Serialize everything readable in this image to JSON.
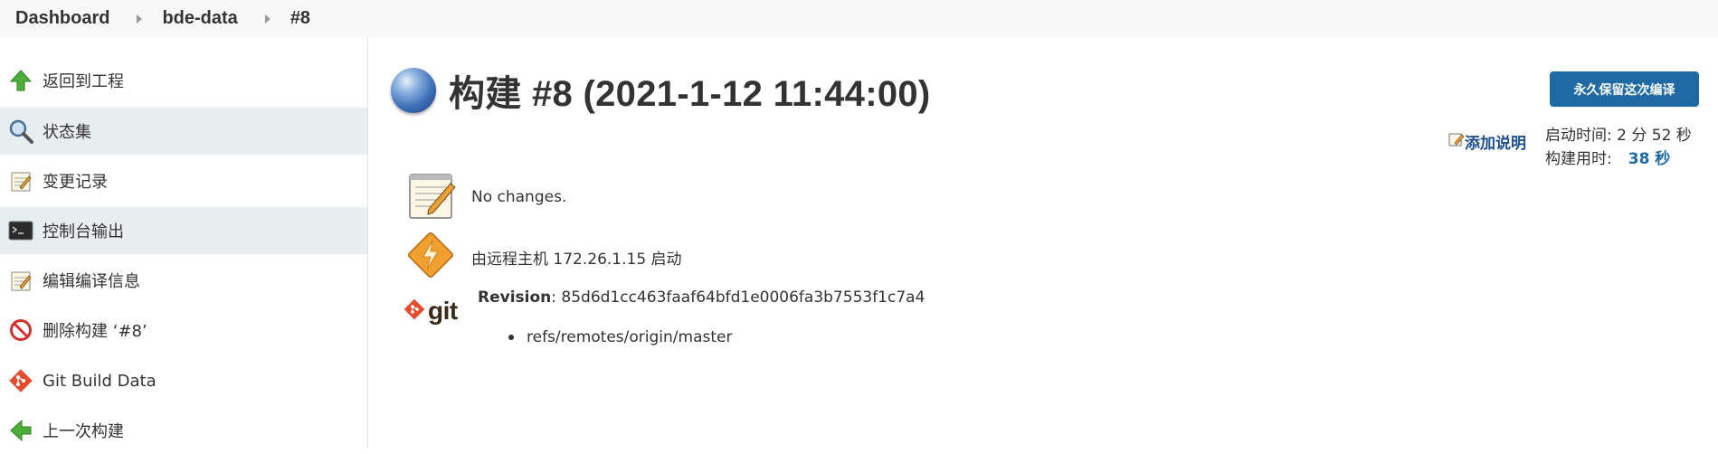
{
  "breadcrumb": {
    "dashboard": "Dashboard",
    "project": "bde-data",
    "build": "#8"
  },
  "sidebar": {
    "items": [
      {
        "label": "返回到工程",
        "icon": "up-arrow-icon"
      },
      {
        "label": "状态集",
        "icon": "magnifier-icon"
      },
      {
        "label": "变更记录",
        "icon": "notepad-icon"
      },
      {
        "label": "控制台输出",
        "icon": "terminal-icon"
      },
      {
        "label": "编辑编译信息",
        "icon": "notepad-icon"
      },
      {
        "label": "删除构建 ‘#8’",
        "icon": "no-entry-icon"
      },
      {
        "label": "Git Build Data",
        "icon": "git-icon"
      },
      {
        "label": "上一次构建",
        "icon": "left-arrow-icon"
      }
    ]
  },
  "build": {
    "title": "构建 #8 (2021-1-12 11:44:00)",
    "keep_forever_label": "永久保留这次编译",
    "add_description_label": "添加说明",
    "started_label": "启动时间: 2 分 52 秒",
    "duration_label": "构建用时:",
    "duration_value": "38 秒",
    "changes_text": "No changes.",
    "cause_text": "由远程主机 172.26.1.15 启动",
    "revision_label": "Revision",
    "revision_value": ": 85d6d1cc463faaf64bfd1e0006fa3b7553f1c7a4",
    "branch": "refs/remotes/origin/master",
    "git_logo_text": "git"
  },
  "colors": {
    "button_bg": "#1f6aa5",
    "link": "#1f4e8c",
    "active_row": "#e8eef0"
  }
}
